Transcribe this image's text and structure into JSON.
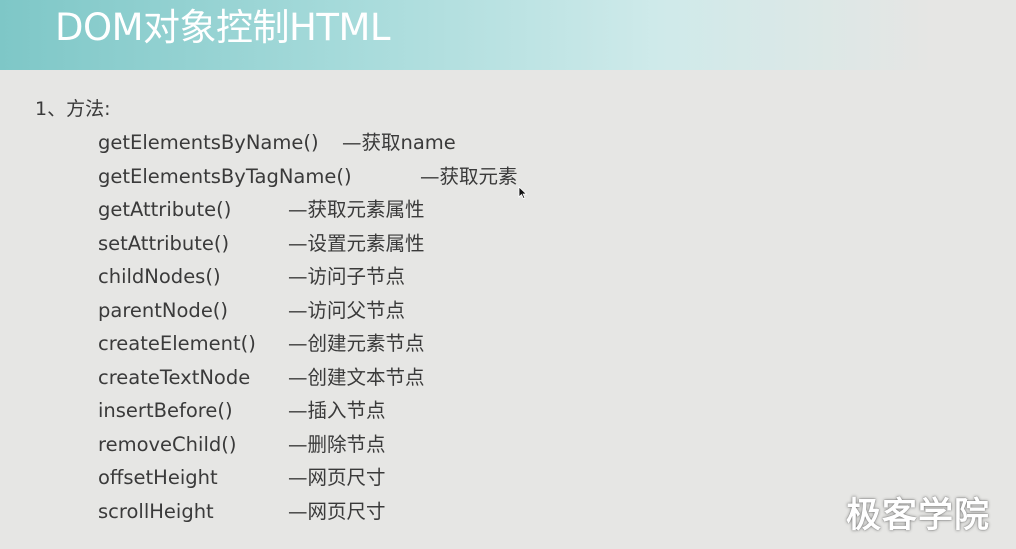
{
  "slide": {
    "title": "DOM对象控制HTML",
    "section_heading": "1、方法:",
    "methods": [
      {
        "name": "getElementsByName()",
        "description": "—获取name"
      },
      {
        "name": "getElementsByTagName()",
        "description": "—获取元素"
      },
      {
        "name": "getAttribute()",
        "description": "—获取元素属性"
      },
      {
        "name": "setAttribute()",
        "description": "—设置元素属性"
      },
      {
        "name": "childNodes()",
        "description": "—访问子节点"
      },
      {
        "name": "parentNode()",
        "description": "—访问父节点"
      },
      {
        "name": "createElement()",
        "description": "—创建元素节点"
      },
      {
        "name": "createTextNode",
        "description": "—创建文本节点"
      },
      {
        "name": "insertBefore()",
        "description": "—插入节点"
      },
      {
        "name": "removeChild()",
        "description": "—删除节点"
      },
      {
        "name": "offsetHeight",
        "description": "—网页尺寸"
      },
      {
        "name": "scrollHeight",
        "description": "—网页尺寸"
      }
    ]
  },
  "watermark": "极客学院",
  "colors": {
    "title_bar_start": "#7ec7c7",
    "background": "#e6e6e4",
    "text": "#3a3a3a"
  },
  "icons": {
    "cursor": "mouse-pointer-icon"
  }
}
